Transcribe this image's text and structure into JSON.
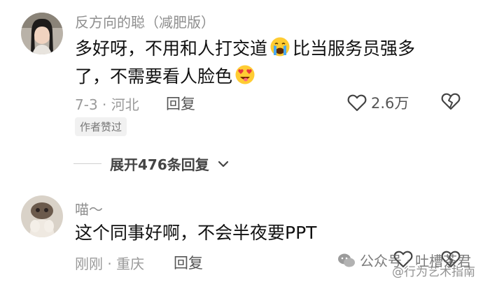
{
  "comments": [
    {
      "username": "反方向的聪（减肥版）",
      "content_line1_a": "多好呀，不用和人打交道",
      "content_line1_b": "比当服务员强多",
      "content_line2": "了，不需要看人脸色",
      "emoji_1": "crying-face-emoji",
      "emoji_2": "heart-eyes-emoji",
      "meta": "7-3 · 河北",
      "reply_label": "回复",
      "like_count": "2.6万",
      "badge": "作者赞过"
    },
    {
      "username": "喵～",
      "content": "这个同事好啊，不会半夜要PPT",
      "meta": "刚刚 · 重庆",
      "reply_label": "回复"
    }
  ],
  "expand_replies": "展开476条回复",
  "watermark": {
    "text": "公众号 · 吐槽茶君",
    "sub": "@行为艺术指南"
  },
  "colors": {
    "text": "#111111",
    "meta": "#9a9a9a",
    "username": "#8e8e8e"
  }
}
